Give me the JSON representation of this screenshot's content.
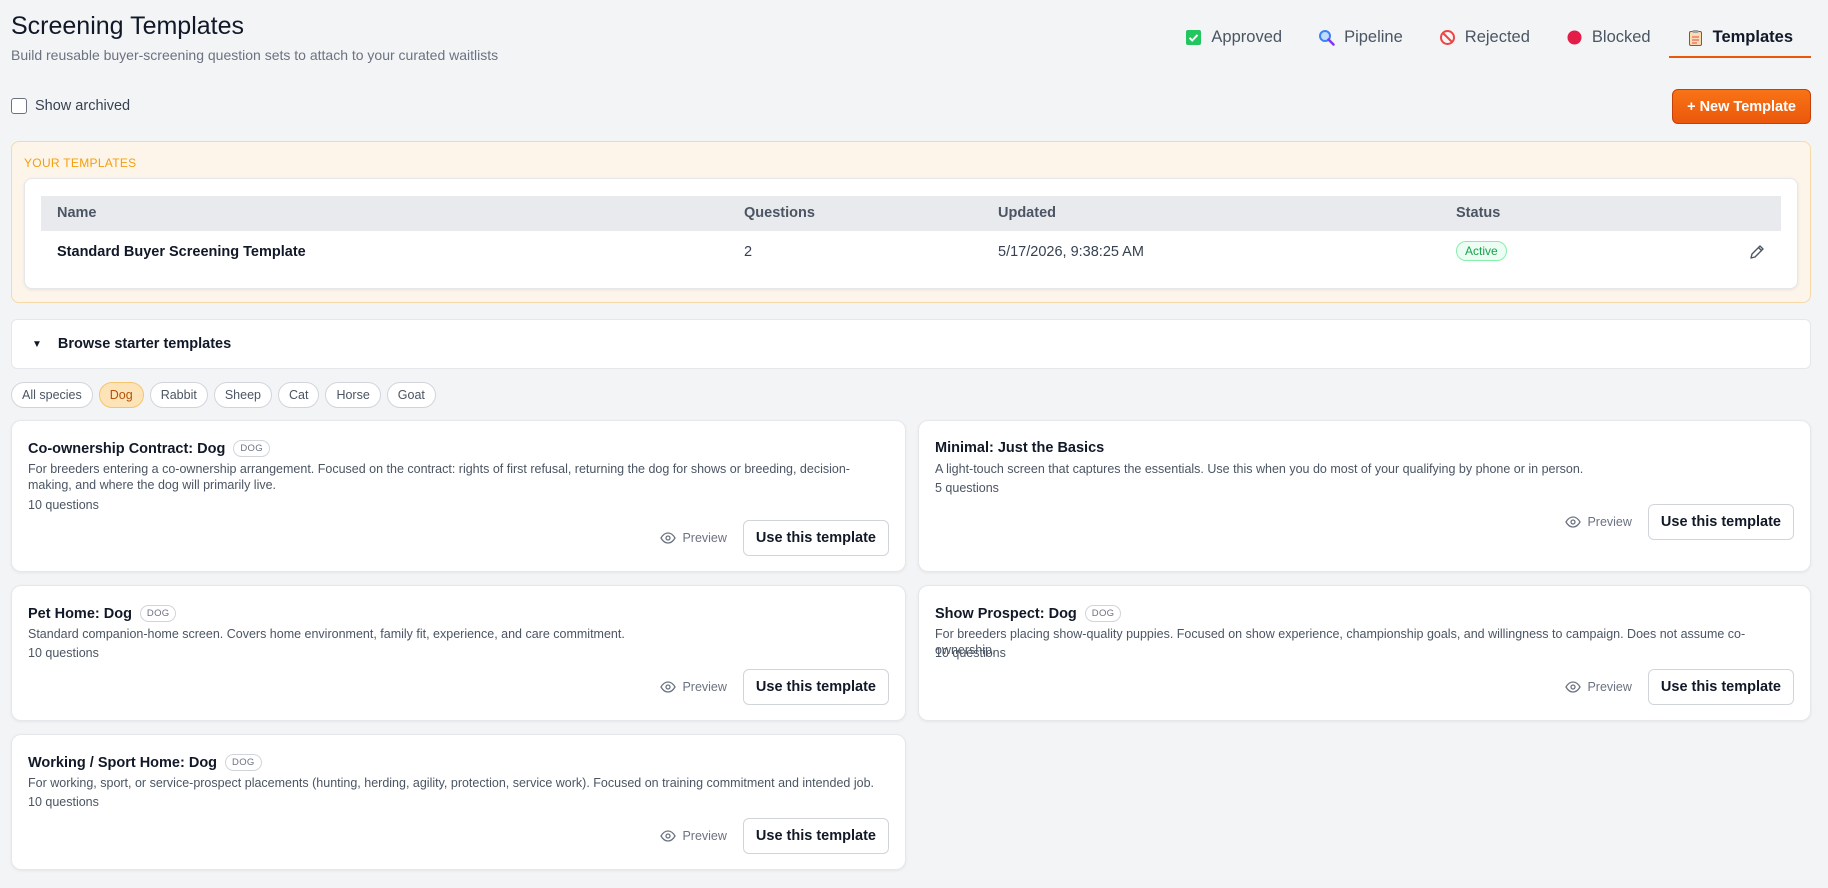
{
  "header": {
    "title": "Screening Templates",
    "subtitle": "Build reusable buyer-screening question sets to attach to your curated waitlists"
  },
  "tabs": [
    {
      "label": "Approved",
      "icon": "approved-check-icon",
      "color": "#22c55e"
    },
    {
      "label": "Pipeline",
      "icon": "magnifier-icon",
      "color": "#3b82f6"
    },
    {
      "label": "Rejected",
      "icon": "prohibited-icon",
      "color": "#ef4444"
    },
    {
      "label": "Blocked",
      "icon": "red-circle-icon",
      "color": "#e11d48"
    },
    {
      "label": "Templates",
      "icon": "clipboard-icon",
      "color": "#ea580c",
      "active": true
    }
  ],
  "toolbar": {
    "show_archived_label": "Show archived",
    "show_archived_checked": false,
    "new_template_label": "+ New Template"
  },
  "your_templates": {
    "section_label": "YOUR TEMPLATES",
    "columns": {
      "name": "Name",
      "questions": "Questions",
      "updated": "Updated",
      "status": "Status"
    },
    "rows": [
      {
        "name": "Standard Buyer Screening Template",
        "questions": "2",
        "updated": "5/17/2026, 9:38:25 AM",
        "status": "Active"
      }
    ]
  },
  "browse": {
    "label": "Browse starter templates",
    "species_filters": [
      "All species",
      "Dog",
      "Rabbit",
      "Sheep",
      "Cat",
      "Horse",
      "Goat"
    ],
    "active_filter": "Dog"
  },
  "starter_templates": [
    {
      "title": "Co-ownership Contract: Dog",
      "species": "DOG",
      "description": "For breeders entering a co-ownership arrangement. Focused on the contract: rights of first refusal, returning the dog for shows or breeding, decision-making, and where the dog will primarily live.",
      "count": "10 questions",
      "preview_label": "Preview",
      "use_label": "Use this template"
    },
    {
      "title": "Minimal: Just the Basics",
      "species": "",
      "description": "A light-touch screen that captures the essentials. Use this when you do most of your qualifying by phone or in person.",
      "count": "5 questions",
      "preview_label": "Preview",
      "use_label": "Use this template"
    },
    {
      "title": "Pet Home: Dog",
      "species": "DOG",
      "description": "Standard companion-home screen. Covers home environment, family fit, experience, and care commitment.",
      "count": "10 questions",
      "preview_label": "Preview",
      "use_label": "Use this template"
    },
    {
      "title": "Show Prospect: Dog",
      "species": "DOG",
      "description": "For breeders placing show-quality puppies. Focused on show experience, championship goals, and willingness to campaign. Does not assume co-ownership.",
      "count": "10 questions",
      "preview_label": "Preview",
      "use_label": "Use this template"
    },
    {
      "title": "Working / Sport Home: Dog",
      "species": "DOG",
      "description": "For working, sport, or service-prospect placements (hunting, herding, agility, protection, service work). Focused on training commitment and intended job.",
      "count": "10 questions",
      "preview_label": "Preview",
      "use_label": "Use this template"
    }
  ],
  "colors": {
    "accent": "#ea580c",
    "active_green": "#16a34a",
    "chip_active_bg": "#fde3b8"
  }
}
